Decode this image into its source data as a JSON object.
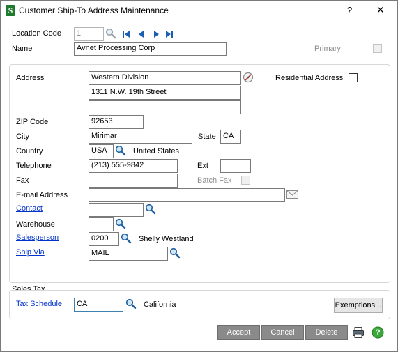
{
  "window": {
    "title": "Customer Ship-To Address Maintenance",
    "help_glyph": "?",
    "close_glyph": "✕"
  },
  "header": {
    "location_code_label": "Location Code",
    "location_code_value": "1",
    "name_label": "Name",
    "name_value": "Avnet Processing Corp",
    "primary_label": "Primary"
  },
  "address": {
    "address_label": "Address",
    "line1": "Western Division",
    "line2": "1311 N.W. 19th Street",
    "line3": "",
    "residential_label": "Residential Address",
    "zip_label": "ZIP Code",
    "zip_value": "92653",
    "city_label": "City",
    "city_value": "Mirimar",
    "state_label": "State",
    "state_value": "CA",
    "country_label": "Country",
    "country_value": "USA",
    "country_name": "United States",
    "telephone_label": "Telephone",
    "telephone_value": "(213) 555-9842",
    "ext_label": "Ext",
    "ext_value": "",
    "fax_label": "Fax",
    "fax_value": "",
    "batch_fax_label": "Batch Fax",
    "email_label": "E-mail Address",
    "email_value": "",
    "contact_label": "Contact",
    "contact_value": "",
    "warehouse_label": "Warehouse",
    "warehouse_value": "",
    "salesperson_label": "Salesperson",
    "salesperson_value": "0200",
    "salesperson_name": "Shelly Westland",
    "ship_via_label": "Ship Via",
    "ship_via_value": "MAIL"
  },
  "sales_tax": {
    "section_label": "Sales Tax",
    "tax_schedule_label": "Tax Schedule",
    "tax_schedule_value": "CA",
    "tax_schedule_name": "California",
    "exemptions_label": "Exemptions..."
  },
  "footer": {
    "accept_label": "Accept",
    "cancel_label": "Cancel",
    "delete_label": "Delete"
  },
  "colors": {
    "app_icon_bg": "#1f7a2e",
    "button_dark": "#8a8a8a",
    "help_green": "#3aa83a",
    "link": "#0033cc"
  }
}
